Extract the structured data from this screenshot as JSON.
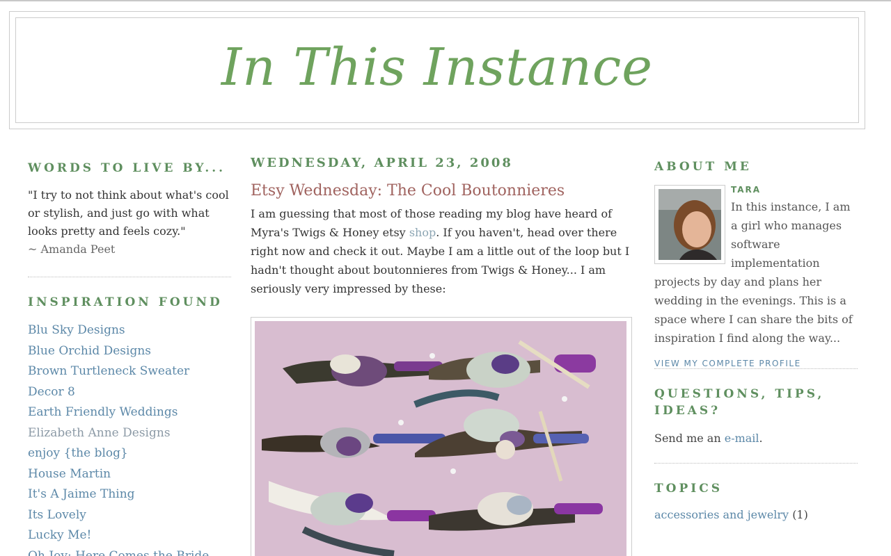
{
  "header": {
    "title": "In This Instance"
  },
  "sidebar_left": {
    "quote_heading": "WORDS TO LIVE BY...",
    "quote_text": "\"I try to not think about what's cool or stylish, and just go with what looks pretty and feels cozy.\"",
    "quote_author": "~ Amanda Peet",
    "links_heading": "INSPIRATION FOUND",
    "links": [
      {
        "label": "Blu Sky Designs"
      },
      {
        "label": "Blue Orchid Designs"
      },
      {
        "label": "Brown Turtleneck Sweater"
      },
      {
        "label": "Decor 8"
      },
      {
        "label": "Earth Friendly Weddings"
      },
      {
        "label": "Elizabeth Anne Designs"
      },
      {
        "label": "enjoy {the blog}"
      },
      {
        "label": "House Martin"
      },
      {
        "label": "It's A Jaime Thing"
      },
      {
        "label": "Its Lovely"
      },
      {
        "label": "Lucky Me!"
      },
      {
        "label": "Oh Joy: Here Comes the Bride"
      }
    ]
  },
  "post": {
    "date": "WEDNESDAY, APRIL 23, 2008",
    "title": "Etsy Wednesday: The Cool Boutonnieres",
    "body_part1": "I am guessing that most of those reading my blog have heard of Myra's Twigs & Honey etsy ",
    "body_link": "shop",
    "body_part2": ". If you haven't, head over there right now and check it out. Maybe I am a little out of the loop but I hadn't thought about boutonnieres from Twigs & Honey... I am seriously very impressed by these:"
  },
  "sidebar_right": {
    "about_heading": "ABOUT ME",
    "profile_name": "TARA",
    "profile_text": "In this instance, I am a girl who manages software implementation projects by day and plans her wedding in the evenings. This is a space where I can share the bits of inspiration I find along the way...",
    "view_profile": "VIEW MY COMPLETE PROFILE",
    "questions_heading": "QUESTIONS, TIPS, IDEAS?",
    "questions_text_before": "Send me an ",
    "questions_link": "e-mail",
    "questions_text_after": ".",
    "topics_heading": "TOPICS",
    "topics": [
      {
        "label": "accessories and jewelry",
        "count": "(1)"
      }
    ]
  },
  "colors": {
    "heading_green": "#5f8f5f",
    "title_green": "#6fa35e",
    "link_blue": "#5c88a8",
    "post_title": "#a0635f"
  }
}
